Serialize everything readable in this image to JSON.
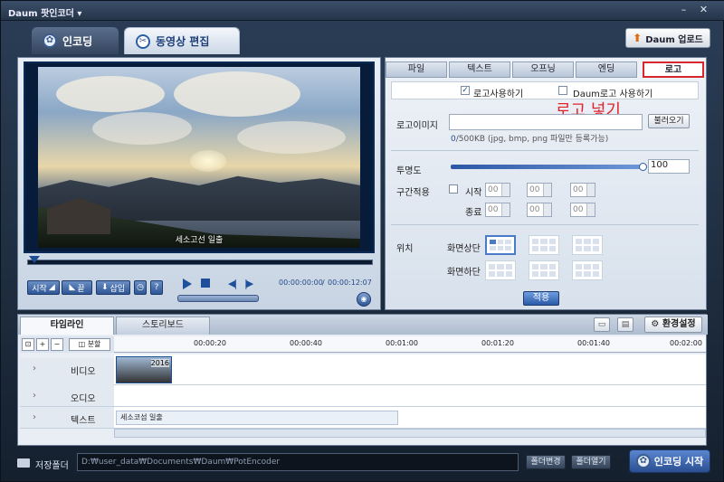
{
  "app": {
    "title": "Daum 팟인코더 ▾"
  },
  "main_tabs": [
    {
      "label": "인코딩"
    },
    {
      "label": "동영상 편집"
    }
  ],
  "upload_button": "Daum 업로드",
  "player": {
    "caption": "세소고선 일출",
    "time_current": "00:00:00:00",
    "time_total": "00:00:12:07",
    "start_label": "시작",
    "end_label": "끝",
    "insert_label": "삽입"
  },
  "right_tabs": [
    {
      "label": "파일"
    },
    {
      "label": "텍스트"
    },
    {
      "label": "오프닝"
    },
    {
      "label": "엔딩"
    },
    {
      "label": "로고"
    }
  ],
  "logo": {
    "use_logo_label": "로고사용하기",
    "use_logo_checked": true,
    "use_daum_logo_label": "Daum로고 사용하기",
    "use_daum_logo_checked": false,
    "annotation": "로고 넣기",
    "image_label": "로고이미지",
    "image_value": "",
    "browse_button": "불러오기",
    "size_hint_prefix": "0",
    "size_hint_rest": "/500KB (jpg, bmp, png 파일만 등록가능)",
    "opacity_label": "투명도",
    "opacity_value": "100",
    "range_label": "구간적용",
    "start_label": "시작",
    "end_label": "종료",
    "start_values": [
      "00",
      "00",
      "00"
    ],
    "end_values": [
      "00",
      "00",
      "00"
    ],
    "position_label": "위치",
    "top_label": "화면상단",
    "bottom_label": "화면하단",
    "apply_button": "적용"
  },
  "bottom_tabs": [
    {
      "label": "타임라인"
    },
    {
      "label": "스토리보드"
    }
  ],
  "settings_button": "환경설정",
  "tools": {
    "split_label": "분할"
  },
  "ruler": [
    "00:00:20",
    "00:00:40",
    "00:01:00",
    "00:01:20",
    "00:01:40",
    "00:02:00"
  ],
  "tracks": [
    {
      "label": "비디오"
    },
    {
      "label": "오디오"
    },
    {
      "label": "텍스트"
    }
  ],
  "clip": {
    "label": "2016",
    "text": "세소코섬 일출"
  },
  "footer": {
    "folder_label": "저장폴더",
    "path": "D:₩user_data₩Documents₩Daum₩PotEncoder",
    "change_button": "폴더변경",
    "open_button": "폴더열기",
    "encode_button": "인코딩 시작"
  },
  "colors": {
    "accent": "#2c57a4",
    "annotation": "#e0232a"
  }
}
